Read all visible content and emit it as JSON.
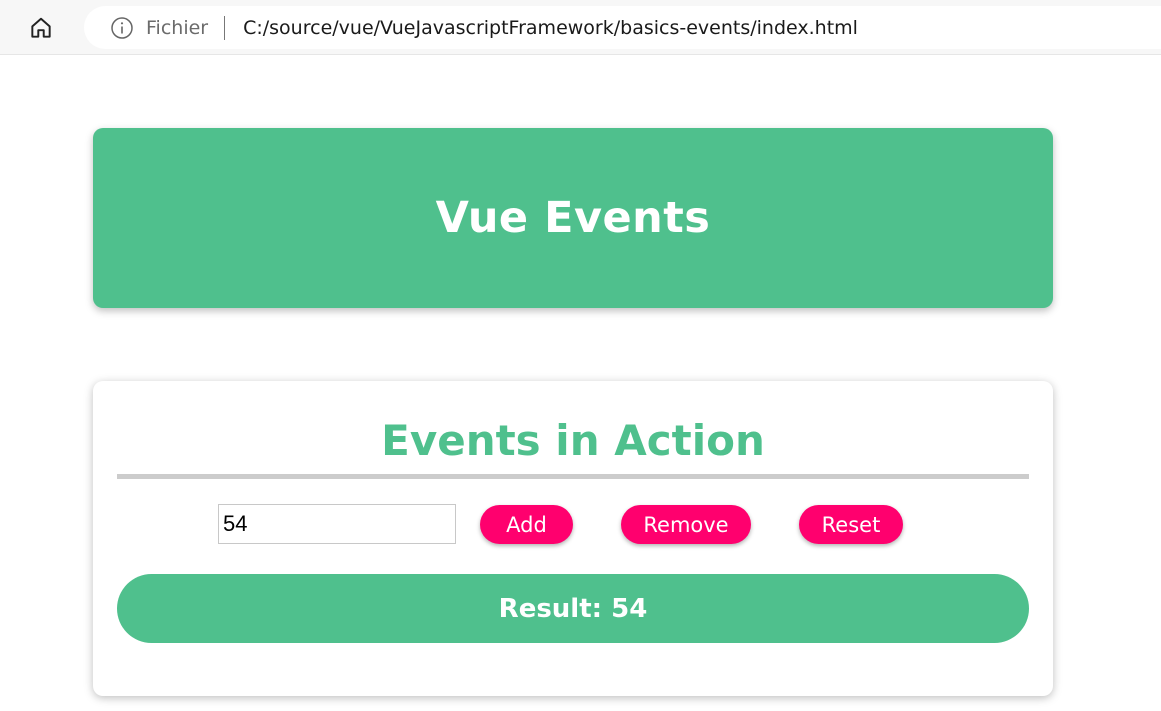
{
  "browser": {
    "origin_label": "Fichier",
    "url": "C:/source/vue/VueJavascriptFramework/basics-events/index.html",
    "icons": {
      "home": "home-icon",
      "info": "info-icon"
    }
  },
  "header": {
    "title": "Vue Events"
  },
  "events": {
    "title": "Events in Action",
    "input_value": "54",
    "buttons": {
      "add": "Add",
      "remove": "Remove",
      "reset": "Reset"
    },
    "result_label": "Result:",
    "result_value": "54"
  },
  "colors": {
    "vue_green": "#4fc08d",
    "button_pink": "#ff006e",
    "divider_gray": "#cccccc"
  }
}
